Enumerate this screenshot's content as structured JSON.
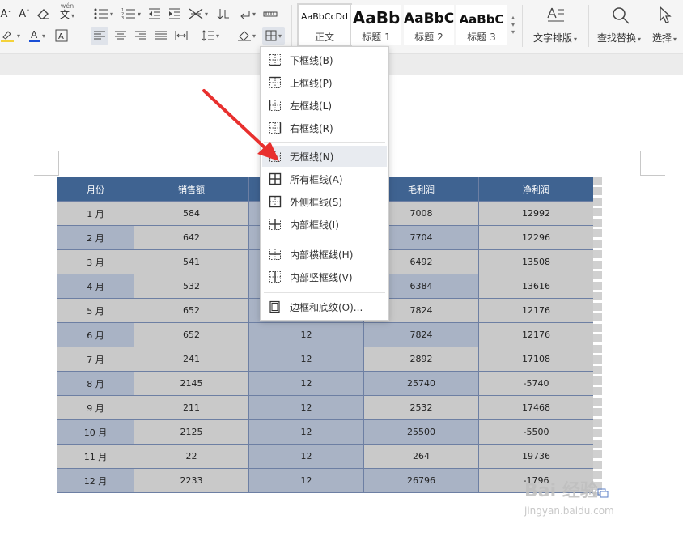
{
  "ribbon": {
    "styles": [
      {
        "sample": "AaBbCcDd",
        "name": "正文"
      },
      {
        "sample": "AaBb",
        "name": "标题 1"
      },
      {
        "sample": "AaBbC",
        "name": "标题 2"
      },
      {
        "sample": "AaBbC",
        "name": "标题 3"
      }
    ],
    "text_layout_label": "文字排版",
    "find_replace_label": "查找替换",
    "select_label": "选择",
    "phonetic_glyph": "wén"
  },
  "border_menu": {
    "items": [
      {
        "label": "下框线(B)",
        "icon": "border-bottom-icon"
      },
      {
        "label": "上框线(P)",
        "icon": "border-top-icon"
      },
      {
        "label": "左框线(L)",
        "icon": "border-left-icon"
      },
      {
        "label": "右框线(R)",
        "icon": "border-right-icon"
      },
      {
        "label": "无框线(N)",
        "icon": "border-none-icon",
        "highlighted": true
      },
      {
        "label": "所有框线(A)",
        "icon": "border-all-icon"
      },
      {
        "label": "外侧框线(S)",
        "icon": "border-outside-icon"
      },
      {
        "label": "内部框线(I)",
        "icon": "border-inside-icon"
      },
      {
        "label": "内部横框线(H)",
        "icon": "border-inside-horizontal-icon"
      },
      {
        "label": "内部竖框线(V)",
        "icon": "border-inside-vertical-icon"
      },
      {
        "label": "边框和底纹(O)...",
        "icon": "borders-and-shading-icon"
      }
    ]
  },
  "table": {
    "headers": [
      "月份",
      "销售额",
      "",
      "毛利润",
      "净利润"
    ],
    "rows": [
      [
        "1 月",
        "584",
        "",
        "7008",
        "12992"
      ],
      [
        "2 月",
        "642",
        "",
        "7704",
        "12296"
      ],
      [
        "3 月",
        "541",
        "",
        "6492",
        "13508"
      ],
      [
        "4 月",
        "532",
        "",
        "6384",
        "13616"
      ],
      [
        "5 月",
        "652",
        "",
        "7824",
        "12176"
      ],
      [
        "6 月",
        "652",
        "12",
        "7824",
        "12176"
      ],
      [
        "7 月",
        "241",
        "12",
        "2892",
        "17108"
      ],
      [
        "8 月",
        "2145",
        "12",
        "25740",
        "-5740"
      ],
      [
        "9 月",
        "211",
        "12",
        "2532",
        "17468"
      ],
      [
        "10 月",
        "2125",
        "12",
        "25500",
        "-5500"
      ],
      [
        "11 月",
        "22",
        "12",
        "264",
        "19736"
      ],
      [
        "12 月",
        "2233",
        "12",
        "26796",
        "-1796"
      ]
    ]
  },
  "watermark": {
    "brand": "Bai 经验",
    "url": "jingyan.baidu.com"
  },
  "colors": {
    "header_bg": "#3f6391",
    "row_gray": "#c9c9c9",
    "row_blue": "#a9b3c5",
    "arrow": "#e8302e",
    "font_color_underline": "#1a4fd6",
    "highlight_underline": "#f4d23a"
  }
}
